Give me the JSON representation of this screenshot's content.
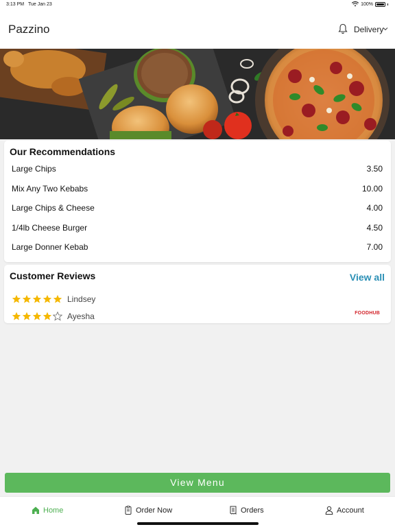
{
  "status_bar": {
    "time": "3:13 PM",
    "date": "Tue Jan 23",
    "battery": "100%"
  },
  "header": {
    "title": "Pazzino",
    "delivery_label": "Delivery"
  },
  "recommendations": {
    "title": "Our Recommendations",
    "items": [
      {
        "name": "Large Chips",
        "price": "3.50"
      },
      {
        "name": "Mix Any Two Kebabs",
        "price": "10.00"
      },
      {
        "name": "Large Chips & Cheese",
        "price": "4.00"
      },
      {
        "name": "1/4lb Cheese Burger",
        "price": "4.50"
      },
      {
        "name": "Large Donner Kebab",
        "price": "7.00"
      }
    ]
  },
  "reviews": {
    "title": "Customer Reviews",
    "view_all": "View all",
    "items": [
      {
        "name": "Lindsey",
        "rating": 5
      },
      {
        "name": "Ayesha",
        "rating": 4
      }
    ],
    "source_logo": "FOODHUB"
  },
  "view_menu_label": "View Menu",
  "tabs": [
    {
      "label": "Home",
      "icon": "home-icon",
      "active": true
    },
    {
      "label": "Order Now",
      "icon": "order-icon",
      "active": false
    },
    {
      "label": "Orders",
      "icon": "receipt-icon",
      "active": false
    },
    {
      "label": "Account",
      "icon": "user-icon",
      "active": false
    }
  ],
  "colors": {
    "accent_green": "#5cb85c",
    "link_blue": "#2a8fb5",
    "star_gold": "#f5b800",
    "foodhub_red": "#d2232a"
  }
}
